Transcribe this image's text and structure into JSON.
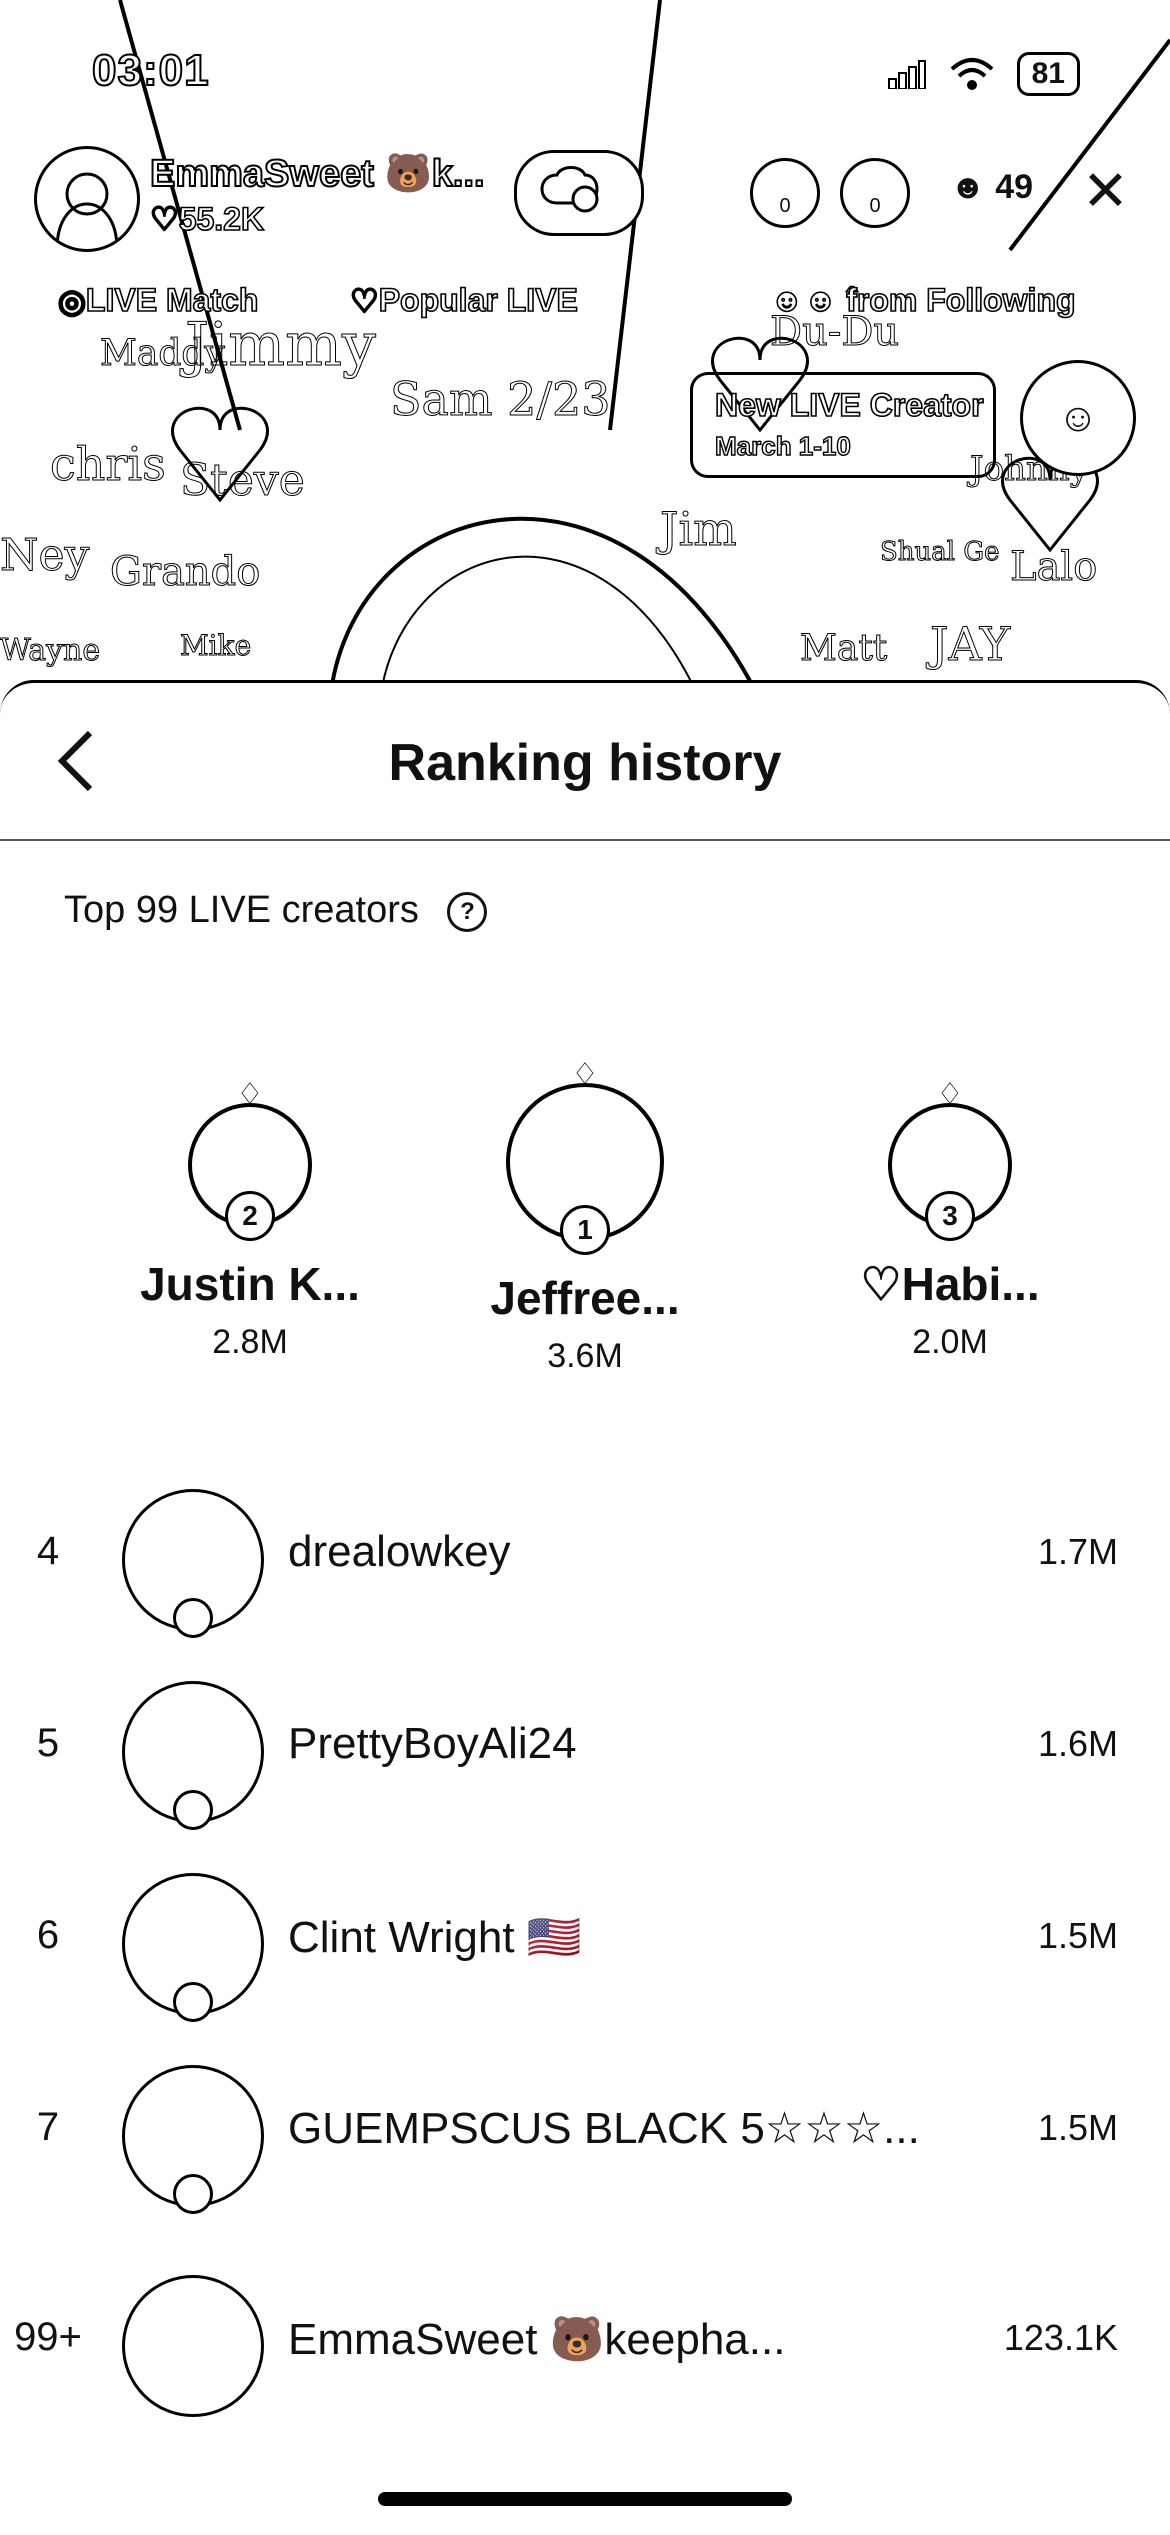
{
  "status_bar": {
    "time": "03:01",
    "battery": "81"
  },
  "live": {
    "host_name": "EmmaSweet 🐻k...",
    "host_likes": "♡55.2K",
    "viewer_badges": [
      "0",
      "0"
    ],
    "viewer_count": "49",
    "tabs": [
      "LIVE Match",
      "Popular LIVE",
      "from Following"
    ],
    "creator_banner": {
      "title": "New LIVE Creator",
      "subtitle": "March 1-10"
    }
  },
  "sheet": {
    "title": "Ranking history",
    "section_label": "Top 99 LIVE creators",
    "help_icon": "?"
  },
  "podium": [
    {
      "rank": "2",
      "name": "Justin K...",
      "score": "2.8M"
    },
    {
      "rank": "1",
      "name": "Jeffree...",
      "score": "3.6M"
    },
    {
      "rank": "3",
      "name": "♡Habi...",
      "score": "2.0M"
    }
  ],
  "ranking": [
    {
      "rank": "4",
      "name": "drealowkey",
      "score": "1.7M"
    },
    {
      "rank": "5",
      "name": "PrettyBoyAli24",
      "score": "1.6M"
    },
    {
      "rank": "6",
      "name": "Clint Wright 🇺🇸",
      "score": "1.5M"
    },
    {
      "rank": "7",
      "name": "GUEMPSCUS BLACK 5☆☆☆...",
      "score": "1.5M"
    },
    {
      "rank": "99+",
      "name": "EmmaSweet 🐻keepha...",
      "score": "123.1K"
    }
  ],
  "icons": {
    "back": "chevron-left-icon",
    "close": "close-icon",
    "signal": "signal-icon",
    "wifi": "wifi-icon",
    "viewers": "person-icon",
    "help": "question-circle-icon"
  }
}
